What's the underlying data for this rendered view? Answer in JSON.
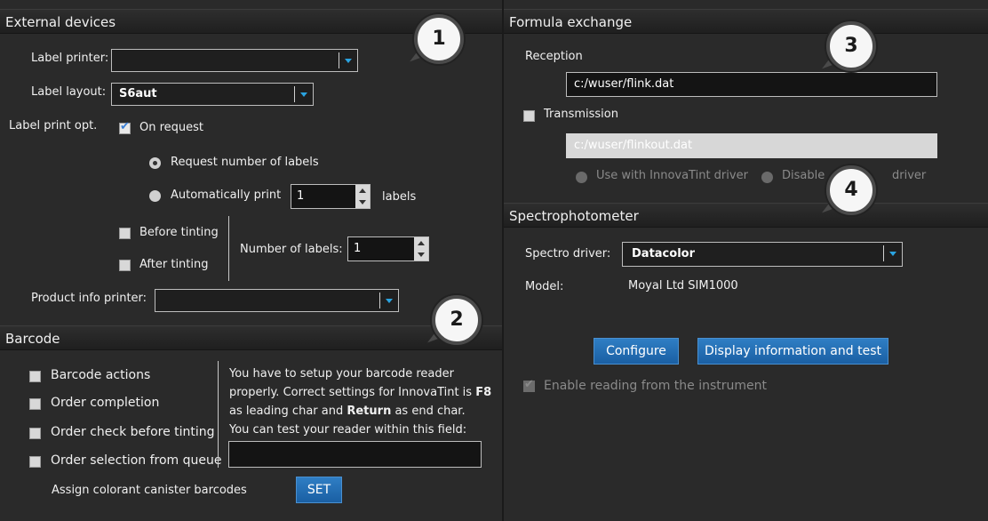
{
  "external_devices": {
    "title": "External devices",
    "label_printer_label": "Label printer:",
    "label_printer_value": "",
    "label_layout_label": "Label layout:",
    "label_layout_value": "S6aut",
    "label_print_opt_label": "Label print opt.",
    "on_request_label": "On request",
    "request_number_label": "Request number of labels",
    "auto_print_label": "Automatically print",
    "auto_print_value": "1",
    "labels_suffix": "labels",
    "before_tinting_label": "Before tinting",
    "after_tinting_label": "After tinting",
    "number_of_labels_label": "Number of labels:",
    "number_of_labels_value": "1",
    "product_info_printer_label": "Product info printer:",
    "product_info_printer_value": ""
  },
  "barcode": {
    "title": "Barcode",
    "barcode_actions": "Barcode actions",
    "order_completion": "Order completion",
    "order_check": "Order check before tinting",
    "order_selection": "Order selection from queue",
    "help_line1": "You have to setup your barcode reader",
    "help_line2_a": "properly. Correct settings for InnovaTint is ",
    "help_line2_b": "F8",
    "help_line3_a": "as leading char and ",
    "help_line3_b": "Return",
    "help_line3_c": " as end char.",
    "help_line4": "You can test your reader within this field:",
    "test_value": "",
    "assign_label": "Assign colorant canister barcodes",
    "set_button": "SET"
  },
  "formula_exchange": {
    "title": "Formula exchange",
    "reception_label": "Reception",
    "reception_value": "c:/wuser/flink.dat",
    "transmission_label": "Transmission",
    "transmission_value": "c:/wuser/flinkout.dat",
    "use_with_driver": "Use with InnovaTint driver",
    "disable_driver_a": "Disable",
    "disable_driver_b": "driver"
  },
  "spectrophotometer": {
    "title": "Spectrophotometer",
    "driver_label": "Spectro driver:",
    "driver_value": "Datacolor",
    "model_label": "Model:",
    "model_value": "Moyal Ltd SIM1000",
    "configure_button": "Configure",
    "display_button": "Display information and test",
    "enable_reading": "Enable reading from the instrument"
  },
  "badges": [
    "1",
    "2",
    "3",
    "4"
  ]
}
